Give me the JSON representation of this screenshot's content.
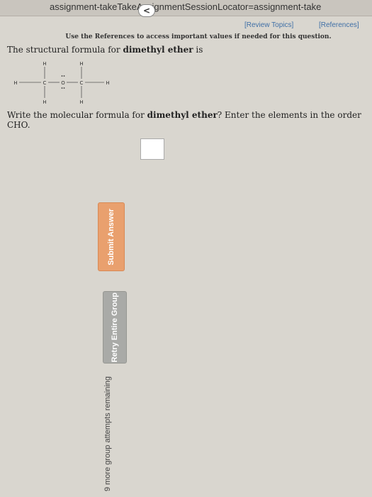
{
  "browser": {
    "url_fragment": "assignment-takeTakeAssignmentSessionLocator=assignment-take"
  },
  "links": {
    "review_topics": "[Review Topics]",
    "references": "[References]"
  },
  "intro": "Use the References to access important values if needed for this question.",
  "question1": {
    "prefix": "The structural formula for ",
    "compound": "dimethyl ether",
    "suffix": " is"
  },
  "structure": {
    "atoms": [
      "H",
      "H",
      "H",
      "H",
      "H",
      "H",
      "C",
      "C",
      "O"
    ]
  },
  "question2": {
    "prefix": "Write the molecular formula for ",
    "compound": "dimethyl ether",
    "suffix": "? Enter the elements in the order CHO."
  },
  "answer": {
    "value": ""
  },
  "buttons": {
    "submit": "Submit Answer",
    "retry": "Retry Entire Group"
  },
  "attempts": "9 more group attempts remaining",
  "icons": {
    "back": "chevron-left-icon"
  },
  "colors": {
    "submit_bg": "#e9a06e",
    "retry_bg": "#a9aaa7",
    "link": "#3f6fa6"
  }
}
